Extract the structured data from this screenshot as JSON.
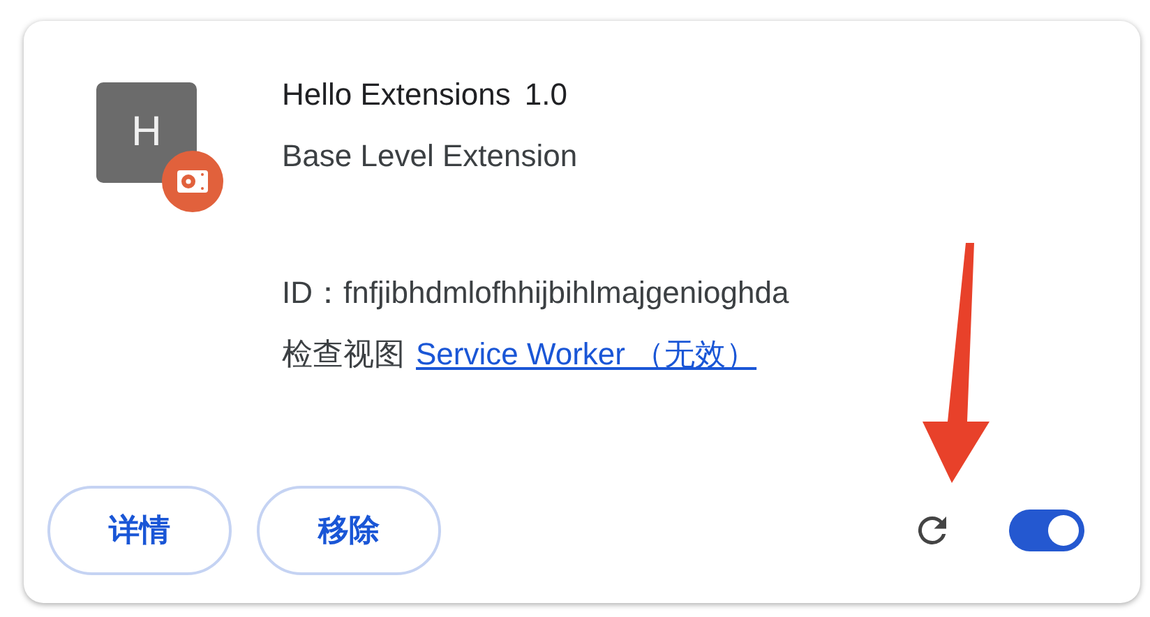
{
  "extension": {
    "icon_letter": "H",
    "name": "Hello Extensions",
    "version": "1.0",
    "description": "Base Level Extension",
    "id_label": "ID：fnfjibhdmlofhhijbihlmajgenioghda",
    "inspect_label": "检查视图",
    "inspect_link": "Service Worker （无效）"
  },
  "buttons": [
    {
      "label": "详情"
    },
    {
      "label": "移除"
    }
  ],
  "toggle": {
    "on": true
  }
}
